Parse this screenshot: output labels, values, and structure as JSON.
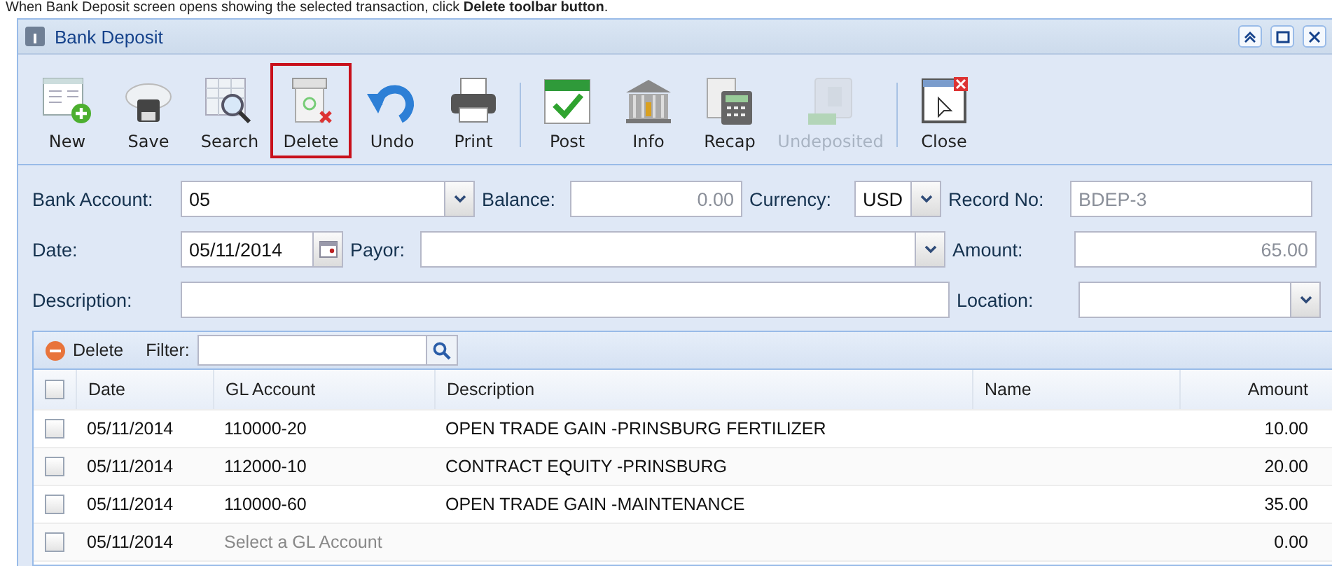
{
  "caption": "When Bank Deposit screen opens showing the selected transaction, click **Delete toolbar button**.",
  "window": {
    "title": "Bank Deposit"
  },
  "toolbar": [
    {
      "label": "New",
      "kind": "new",
      "disabled": false,
      "highlighted": false
    },
    {
      "label": "Save",
      "kind": "save",
      "disabled": false,
      "highlighted": false
    },
    {
      "label": "Search",
      "kind": "search",
      "disabled": false,
      "highlighted": false
    },
    {
      "label": "Delete",
      "kind": "delete",
      "disabled": false,
      "highlighted": true
    },
    {
      "label": "Undo",
      "kind": "undo",
      "disabled": false,
      "highlighted": false
    },
    {
      "label": "Print",
      "kind": "print",
      "disabled": false,
      "highlighted": false
    },
    {
      "label": "Post",
      "kind": "post",
      "disabled": false,
      "highlighted": false
    },
    {
      "label": "Info",
      "kind": "info",
      "disabled": false,
      "highlighted": false
    },
    {
      "label": "Recap",
      "kind": "recap",
      "disabled": false,
      "highlighted": false
    },
    {
      "label": "Undeposited",
      "kind": "undeposited",
      "disabled": true,
      "highlighted": false
    },
    {
      "label": "Close",
      "kind": "close",
      "disabled": false,
      "highlighted": false
    }
  ],
  "form": [
    [
      {
        "label": "Bank Account:",
        "value": "05",
        "kind": "combo",
        "readonly": false
      },
      {
        "label": "Balance:",
        "value": "0.00",
        "kind": "number",
        "readonly": true
      },
      {
        "label": "Currency:",
        "value": "USD",
        "kind": "combo",
        "readonly": false
      },
      {
        "label": "Record No:",
        "value": "BDEP-3",
        "kind": "text",
        "readonly": true
      }
    ],
    [
      {
        "label": "Date:",
        "value": "05/11/2014",
        "kind": "date",
        "readonly": false
      },
      {
        "label": "Payor:",
        "kind": "combo"
      },
      {
        "label": "Amount:",
        "value": "65.00",
        "kind": "number",
        "readonly": true
      }
    ],
    [
      {
        "label": "Description:",
        "kind": "text"
      },
      {
        "label": "Location:",
        "kind": "combo"
      }
    ]
  ],
  "grid": {
    "delete_label": "Delete",
    "filter_label": "Filter:",
    "all_checked": false,
    "columns": [
      "Date",
      "GL Account",
      "Description",
      "Name",
      "Amount"
    ],
    "rows": [
      {
        "checked": false,
        "date": "05/11/2014",
        "gl_account": "110000-20",
        "gl_hint": false,
        "description": "OPEN TRADE GAIN -PRINSBURG FERTILIZER",
        "amount": "10.00"
      },
      {
        "checked": false,
        "date": "05/11/2014",
        "gl_account": "112000-10",
        "gl_hint": false,
        "description": "CONTRACT EQUITY -PRINSBURG",
        "amount": "20.00"
      },
      {
        "checked": false,
        "date": "05/11/2014",
        "gl_account": "110000-60",
        "gl_hint": false,
        "description": "OPEN TRADE GAIN -MAINTENANCE",
        "amount": "35.00"
      },
      {
        "checked": false,
        "date": "05/11/2014",
        "gl_account": "Select a GL Account",
        "gl_hint": true,
        "amount": "0.00"
      }
    ]
  }
}
